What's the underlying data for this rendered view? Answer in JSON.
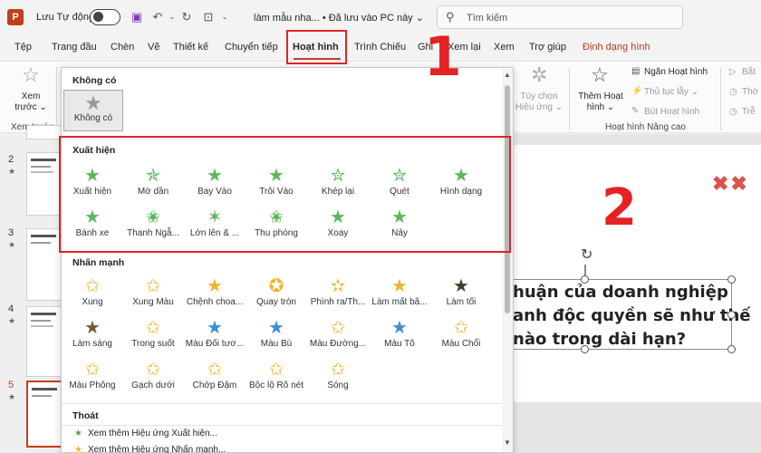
{
  "titlebar": {
    "logo_letter": "P",
    "autosave_label": "Lưu Tự động",
    "doc_title": "làm mẫu nha... • Đã lưu vào PC này ⌄"
  },
  "search": {
    "placeholder": "Tìm kiếm",
    "icon": "search-icon"
  },
  "menubar": {
    "items": [
      "Tệp",
      "Trang đầu",
      "Chèn",
      "Vẽ",
      "Thiết kế",
      "Chuyển tiếp",
      "Hoạt hình",
      "Trình Chiếu",
      "Ghi",
      "Xem lại",
      "Xem",
      "Trợ giúp",
      "Định dạng hình"
    ],
    "active": "Hoạt hình"
  },
  "annotations": {
    "step1": "1",
    "step2": "2"
  },
  "ribbon": {
    "preview_label_1": "Xem",
    "preview_label_2": "trước ⌄",
    "preview_group": "Xem trước",
    "effect_options_1": "Tùy chọn",
    "effect_options_2": "Hiệu ứng ⌄",
    "add_animation_1": "Thêm Hoạt",
    "add_animation_2": "hình ⌄",
    "animation_pane": "Ngăn Hoạt hình",
    "trigger": "Thủ tục lẫy ⌄",
    "animation_painter": "Bút Hoạt hình",
    "advanced_group": "Hoạt hình Nâng cao",
    "start": "Bắt",
    "duration": "Thờ",
    "delay": "Trễ"
  },
  "gallery": {
    "none_section": "Không có",
    "none_item": "Không có",
    "entrance_section": "Xuất hiện",
    "entrance_items": [
      "Xuất hiện",
      "Mờ dần",
      "Bay Vào",
      "Trôi Vào",
      "Khép lại",
      "Quét",
      "Hình dạng",
      "Bánh xe",
      "Thanh Ngẫ...",
      "Lớn lên & ...",
      "Thu phóng",
      "Xoay",
      "Nảy"
    ],
    "emphasis_section": "Nhấn mạnh",
    "emphasis_items": [
      "Xung",
      "Xung Màu",
      "Chệnh choa...",
      "Quay tròn",
      "Phình ra/Th...",
      "Làm mất bã...",
      "Làm tối",
      "Làm sáng",
      "Trong suốt",
      "Màu Đối tươ...",
      "Màu Bù",
      "Màu Đường...",
      "Màu Tô",
      "Màu Chổi",
      "Màu Phông",
      "Gạch dưới",
      "Chớp Đậm",
      "Bộc lộ Rõ nét",
      "Sóng"
    ],
    "exit_section": "Thoát",
    "more_entrance": "Xem thêm Hiệu ứng Xuất hiện...",
    "more_emphasis": "Xem thêm Hiệu ứng Nhấn mạnh..."
  },
  "slides": {
    "numbers": [
      "2",
      "3",
      "4",
      "5"
    ]
  },
  "slide": {
    "lines": [
      "huận của doanh nghiệp",
      "anh độc quyền sẽ như thế",
      "nào trong dài hạn?"
    ],
    "marks": "✖✖"
  },
  "colors": {
    "accent": "#c43e1c",
    "highlight": "#e32222",
    "entrance": "#5cb85c",
    "emphasis": "#f0b429"
  }
}
